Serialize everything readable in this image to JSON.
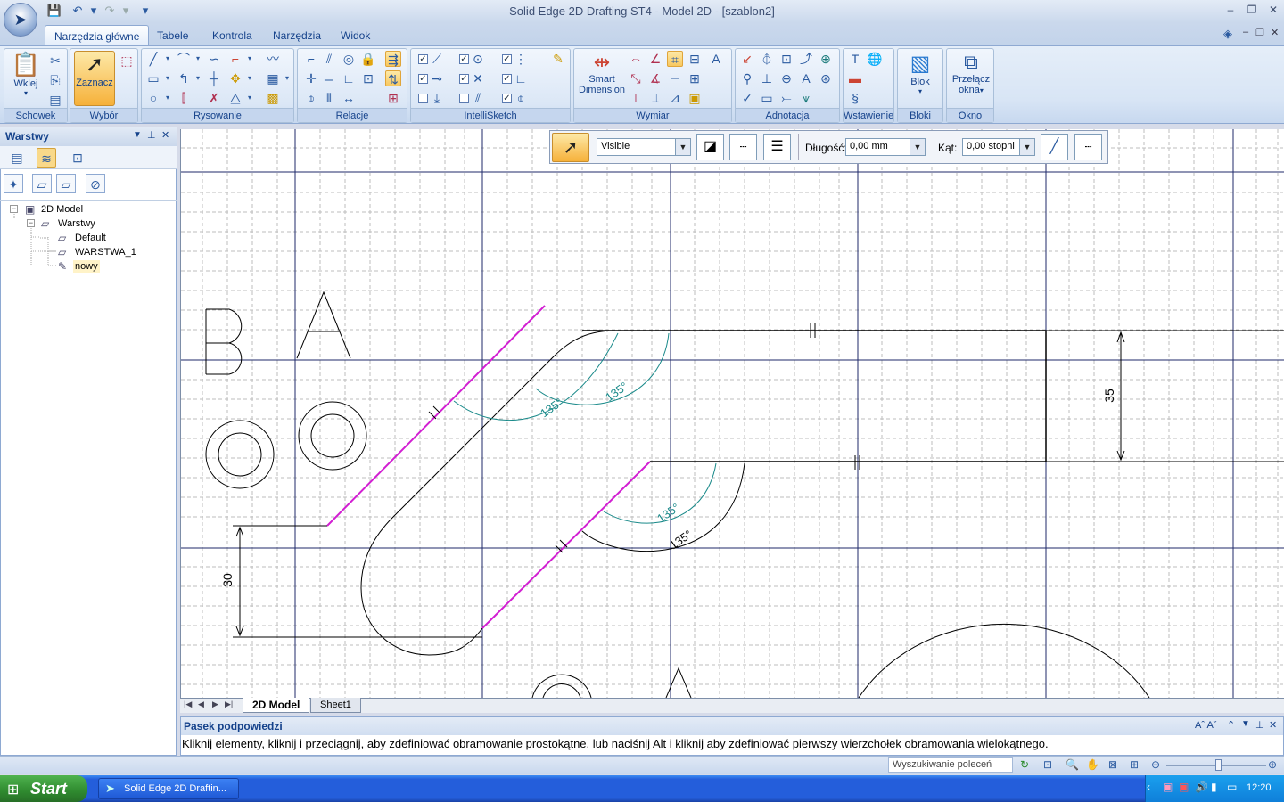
{
  "window": {
    "title": "Solid Edge 2D Drafting ST4 - Model 2D - [szablon2]",
    "min": "–",
    "max": "❐",
    "close": "✕"
  },
  "tabs": [
    "Narzędzia główne",
    "Tabele",
    "Kontrola",
    "Narzędzia",
    "Widok"
  ],
  "ribbon": {
    "schowek": {
      "label": "Schowek",
      "paste": "Wklej"
    },
    "wybor": {
      "label": "Wybór",
      "select": "Zaznacz"
    },
    "rysowanie": {
      "label": "Rysowanie"
    },
    "relacje": {
      "label": "Relacje"
    },
    "intellisketch": {
      "label": "IntelliSketch"
    },
    "wymiar": {
      "label": "Wymiar",
      "smart1": "Smart",
      "smart2": "Dimension"
    },
    "adnotacja": {
      "label": "Adnotacja"
    },
    "wstawienie": {
      "label": "Wstawienie"
    },
    "bloki": {
      "label": "Bloki",
      "blok": "Blok"
    },
    "okno": {
      "label": "Okno",
      "switch1": "Przełącz",
      "switch2": "okna"
    }
  },
  "left_panel": {
    "title": "Warstwy",
    "tree": [
      {
        "label": "2D Model",
        "level": 0
      },
      {
        "label": "Warstwy",
        "level": 1
      },
      {
        "label": "Default",
        "level": 2
      },
      {
        "label": "WARSTWA_1",
        "level": 2
      },
      {
        "label": "nowy",
        "level": 2
      }
    ]
  },
  "floatbar": {
    "linetype": "Visible",
    "length_label": "Długość:",
    "length_value": "0,00 mm",
    "angle_label": "Kąt:",
    "angle_value": "0,00 stopni"
  },
  "drawing": {
    "letters": [
      "B",
      "A"
    ],
    "dims": [
      "35",
      "30",
      "135°",
      "135°",
      "135°",
      "135°"
    ]
  },
  "sheets": [
    "2D Model",
    "Sheet1"
  ],
  "prompt": {
    "title": "Pasek podpowiedzi",
    "text": "Kliknij elementy, kliknij i przeciągnij, aby zdefiniować obramowanie prostokątne, lub naciśnij Alt i kliknij aby zdefiniować pierwszy wierzchołek obramowania wielokątnego."
  },
  "status": {
    "search_placeholder": "Wyszukiwanie poleceń"
  },
  "taskbar": {
    "start": "Start",
    "item": "Solid Edge 2D Draftin...",
    "clock": "12:20"
  },
  "colors": {
    "magenta": "#d21fd2",
    "teal": "#1a8a8a",
    "frame": "#1f2a6a",
    "grid": "#b8b8b8"
  }
}
